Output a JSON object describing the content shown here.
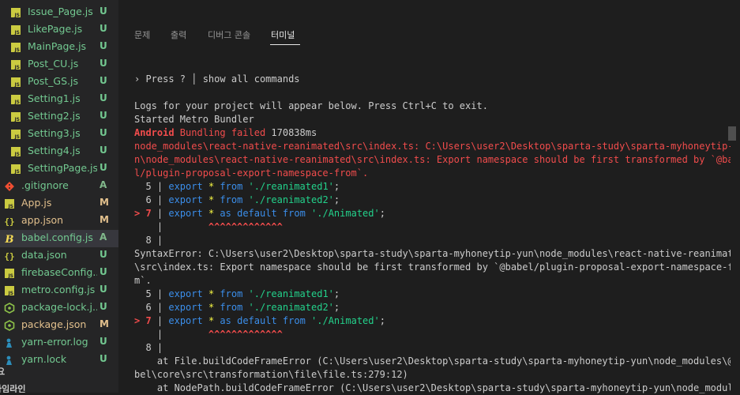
{
  "explorer": {
    "files": [
      {
        "name": "Issue_Page.js",
        "icon": "js-file-icon",
        "type": "js",
        "status": "U"
      },
      {
        "name": "LikePage.js",
        "icon": "js-file-icon",
        "type": "js",
        "status": "U"
      },
      {
        "name": "MainPage.js",
        "icon": "js-file-icon",
        "type": "js",
        "status": "U"
      },
      {
        "name": "Post_CU.js",
        "icon": "js-file-icon",
        "type": "js",
        "status": "U"
      },
      {
        "name": "Post_GS.js",
        "icon": "js-file-icon",
        "type": "js",
        "status": "U"
      },
      {
        "name": "Setting1.js",
        "icon": "js-file-icon",
        "type": "js",
        "status": "U"
      },
      {
        "name": "Setting2.js",
        "icon": "js-file-icon",
        "type": "js",
        "status": "U"
      },
      {
        "name": "Setting3.js",
        "icon": "js-file-icon",
        "type": "js",
        "status": "U"
      },
      {
        "name": "Setting4.js",
        "icon": "js-file-icon",
        "type": "js",
        "status": "U"
      },
      {
        "name": "SettingPage.js",
        "icon": "js-file-icon",
        "type": "js",
        "status": "U"
      },
      {
        "name": ".gitignore",
        "icon": "git-icon",
        "type": "root",
        "status": "A"
      },
      {
        "name": "App.js",
        "icon": "js-file-icon",
        "type": "root",
        "status": "M"
      },
      {
        "name": "app.json",
        "icon": "json-braces-icon",
        "type": "root",
        "status": "M"
      },
      {
        "name": "babel.config.js",
        "icon": "babel-icon",
        "type": "root",
        "status": "A"
      },
      {
        "name": "data.json",
        "icon": "json-braces-icon",
        "type": "root",
        "status": "U"
      },
      {
        "name": "firebaseConfig...",
        "icon": "js-file-icon",
        "type": "root",
        "status": "U"
      },
      {
        "name": "metro.config.js",
        "icon": "js-file-icon",
        "type": "root",
        "status": "U"
      },
      {
        "name": "package-lock.j...",
        "icon": "npm-package-icon",
        "type": "root",
        "status": "U"
      },
      {
        "name": "package.json",
        "icon": "npm-package-icon",
        "type": "root",
        "status": "M"
      },
      {
        "name": "yarn-error.log",
        "icon": "yarn-icon",
        "type": "root",
        "status": "U"
      },
      {
        "name": "yarn.lock",
        "icon": "yarn-icon",
        "type": "root",
        "status": "U"
      }
    ],
    "selected_index": 13,
    "section_outline": "요",
    "section_timeline": "타임라인"
  },
  "panel": {
    "tabs": [
      {
        "label": "문제",
        "active": false
      },
      {
        "label": "출력",
        "active": false
      },
      {
        "label": "디버그 콘솔",
        "active": false
      },
      {
        "label": "터미널",
        "active": true
      }
    ]
  },
  "terminal": {
    "press_prompt": "› Press ? │ show all commands",
    "logs_intro": "Logs for your project will appear below. Press Ctrl+C to exit.",
    "started": "Started Metro Bundler",
    "bundle_platform": "Android",
    "bundle_failed": " Bundling failed ",
    "bundle_time": "170838ms",
    "error_line1": "node_modules\\react-native-reanimated\\src\\index.ts: C:\\Users\\user2\\Desktop\\sparta-study\\sparta-myhoneytip-yu",
    "error_line2": "n\\node_modules\\react-native-reanimated\\src\\index.ts: Export namespace should be first transformed by `@babe",
    "error_line3": "l/plugin-proposal-export-namespace-from`.",
    "code1": {
      "l5_num": "  5 | ",
      "l5_kw": "export",
      "l5_star": " * ",
      "l5_from": "from",
      "l5_str": " './reanimated1'",
      "l5_end": ";",
      "l6_num": "  6 | ",
      "l6_kw": "export",
      "l6_star": " * ",
      "l6_from": "from",
      "l6_str": " './reanimated2'",
      "l6_end": ";",
      "l7_arrow": "> 7",
      "l7_bar": " | ",
      "l7_kw": "export",
      "l7_star": " * ",
      "l7_as": "as default from",
      "l7_str": " './Animated'",
      "l7_end": ";",
      "caret_gutter": "    |        ",
      "carets": "^^^^^^^^^^^^^",
      "l8": "  8 |"
    },
    "syntax_line1": "SyntaxError: C:\\Users\\user2\\Desktop\\sparta-study\\sparta-myhoneytip-yun\\node_modules\\react-native-reanimated",
    "syntax_line2": "\\src\\index.ts: Export namespace should be first transformed by `@babel/plugin-proposal-export-namespace-fro",
    "syntax_line3": "m`.",
    "stack1a": "    at File.buildCodeFrameError (C:\\Users\\user2\\Desktop\\sparta-study\\sparta-myhoneytip-yun\\node_modules\\@ba",
    "stack1b": "bel\\core\\src\\transformation\\file\\file.ts:279:12)",
    "stack2": "    at NodePath.buildCodeFrameError (C:\\Users\\user2\\Desktop\\sparta-study\\sparta-myhoneytip-yun\\node_modules"
  },
  "colors": {
    "untracked": "#73c991",
    "modified": "#e2c08d",
    "error": "#f14c4c",
    "keyword": "#3b8eea",
    "string": "#23d18b"
  }
}
